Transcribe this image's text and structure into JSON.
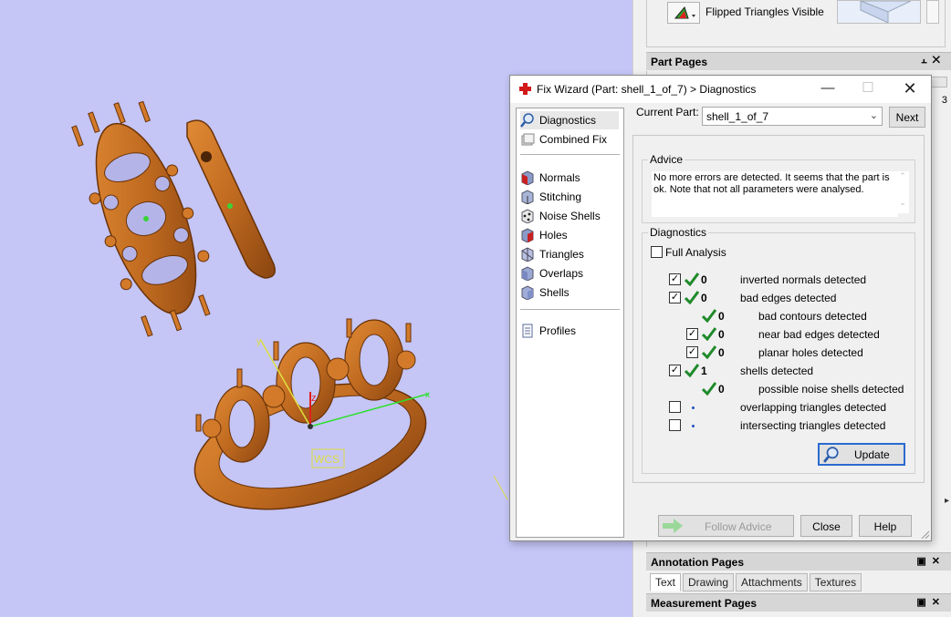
{
  "viewport": {
    "wcs_label": "WCS",
    "axis_z": "z",
    "axis_x": "x",
    "axis_y": "y"
  },
  "right_panel": {
    "flipped_label": "Flipped Triangles Visible",
    "part_pages": {
      "title": "Part Pages"
    },
    "annotation_pages": {
      "title": "Annotation Pages",
      "tabs": [
        "Text",
        "Drawing",
        "Attachments",
        "Textures"
      ]
    },
    "measurement_pages": {
      "title": "Measurement Pages"
    },
    "header_buttons": "✕"
  },
  "dialog": {
    "title": "Fix Wizard (Part: shell_1_of_7) > Diagnostics",
    "nav": [
      {
        "label": "Diagnostics",
        "icon": "magnifier-icon"
      },
      {
        "label": "Combined Fix",
        "icon": "combined-fix-icon"
      },
      {
        "label": "Normals",
        "icon": "normals-icon"
      },
      {
        "label": "Stitching",
        "icon": "stitching-icon"
      },
      {
        "label": "Noise Shells",
        "icon": "noise-shells-icon"
      },
      {
        "label": "Holes",
        "icon": "holes-icon"
      },
      {
        "label": "Triangles",
        "icon": "triangles-icon"
      },
      {
        "label": "Overlaps",
        "icon": "overlaps-icon"
      },
      {
        "label": "Shells",
        "icon": "shells-icon"
      },
      {
        "label": "Profiles",
        "icon": "profiles-icon"
      }
    ],
    "current_part_label": "Current Part:",
    "current_part_value": "shell_1_of_7",
    "next_label": "Next",
    "advice": {
      "title": "Advice",
      "text": "No more errors are detected. It seems that the part is ok. Note that not all parameters were analysed."
    },
    "diagnostics": {
      "title": "Diagnostics",
      "full_analysis_label": "Full Analysis",
      "rows": [
        {
          "checkbox": true,
          "checked": true,
          "status": "ok",
          "count": "0",
          "label": "inverted normals detected",
          "indent": 0
        },
        {
          "checkbox": true,
          "checked": true,
          "status": "ok",
          "count": "0",
          "label": "bad edges detected",
          "indent": 0
        },
        {
          "checkbox": false,
          "checked": false,
          "status": "ok",
          "count": "0",
          "label": "bad contours detected",
          "indent": 1
        },
        {
          "checkbox": true,
          "checked": true,
          "status": "ok",
          "count": "0",
          "label": "near bad edges detected",
          "indent": 1
        },
        {
          "checkbox": true,
          "checked": true,
          "status": "ok",
          "count": "0",
          "label": "planar holes detected",
          "indent": 1
        },
        {
          "checkbox": true,
          "checked": true,
          "status": "ok",
          "count": "1",
          "label": "shells detected",
          "indent": 0
        },
        {
          "checkbox": false,
          "checked": false,
          "status": "ok",
          "count": "0",
          "label": "possible noise shells detected",
          "indent": 1
        },
        {
          "checkbox": true,
          "checked": false,
          "status": "pending",
          "count": "",
          "label": "overlapping triangles detected",
          "indent": 0
        },
        {
          "checkbox": true,
          "checked": false,
          "status": "pending",
          "count": "",
          "label": "intersecting triangles detected",
          "indent": 0
        }
      ]
    },
    "update_label": "Update",
    "follow_advice_label": "Follow Advice",
    "close_label": "Close",
    "help_label": "Help"
  },
  "colors": {
    "viewport_bg": "#c5c5f6",
    "model": "#c56a1e",
    "check_green": "#1e8a2a",
    "selection_blue": "#2a6bd0"
  }
}
